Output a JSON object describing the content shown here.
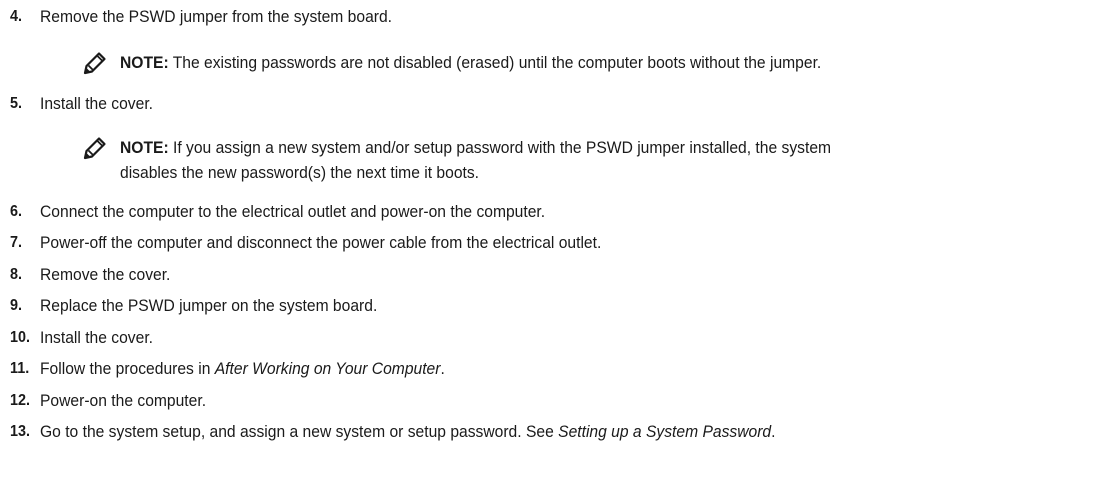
{
  "steps": [
    {
      "num": "4.",
      "text": "Remove the PSWD jumper from the system board."
    },
    {
      "num": "5.",
      "text": "Install the cover."
    },
    {
      "num": "6.",
      "text": "Connect the computer to the electrical outlet and power-on the computer."
    },
    {
      "num": "7.",
      "text": "Power-off the computer and disconnect the power cable from the electrical outlet."
    },
    {
      "num": "8.",
      "text": "Remove the cover."
    },
    {
      "num": "9.",
      "text": "Replace the PSWD jumper on the system board."
    },
    {
      "num": "10.",
      "text": "Install the cover."
    },
    {
      "num": "11.",
      "text_before": "Follow the procedures in ",
      "link": "After Working on Your Computer",
      "text_after": "."
    },
    {
      "num": "12.",
      "text": "Power-on the computer."
    },
    {
      "num": "13.",
      "text_before": "Go to the system setup, and assign a new system or setup password. See ",
      "link": "Setting up a System Password",
      "text_after": "."
    }
  ],
  "notes": [
    {
      "label": "NOTE:",
      "text": " The existing passwords are not disabled (erased) until the computer boots without the jumper.",
      "icon": "note-pencil-icon"
    },
    {
      "label": "NOTE:",
      "line1": " If you assign a new system and/or setup password with the PSWD jumper installed, the system",
      "line2": "disables the new password(s) the next time it boots.",
      "icon": "note-pencil-icon"
    }
  ]
}
